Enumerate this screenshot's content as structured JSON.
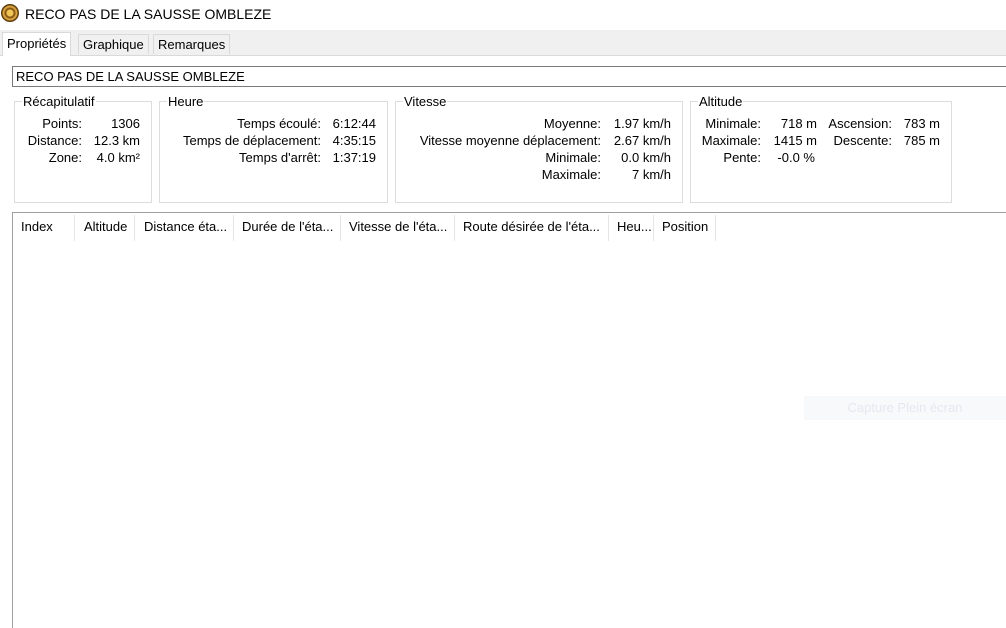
{
  "window": {
    "title": "RECO PAS DE LA SAUSSE OMBLEZE",
    "icon": "app-logo-icon"
  },
  "tabs": [
    {
      "label": "Propriétés",
      "active": true
    },
    {
      "label": "Graphique",
      "active": false
    },
    {
      "label": "Remarques",
      "active": false
    }
  ],
  "name_field": {
    "value": "RECO PAS DE LA SAUSSE OMBLEZE"
  },
  "recap": {
    "title": "Récapitulatif",
    "points_label": "Points:",
    "points_value": "1306",
    "distance_label": "Distance:",
    "distance_value": "12.3 km",
    "zone_label": "Zone:",
    "zone_value": "4.0 km²"
  },
  "heure": {
    "title": "Heure",
    "elapsed_label": "Temps écoulé:",
    "elapsed_value": "6:12:44",
    "moving_label": "Temps de déplacement:",
    "moving_value": "4:35:15",
    "stopped_label": "Temps d'arrêt:",
    "stopped_value": "1:37:19"
  },
  "vitesse": {
    "title": "Vitesse",
    "avg_label": "Moyenne:",
    "avg_value": "1.97 km/h",
    "moving_avg_label": "Vitesse moyenne déplacement:",
    "moving_avg_value": "2.67 km/h",
    "min_label": "Minimale:",
    "min_value": "0.0 km/h",
    "max_label": "Maximale:",
    "max_value": "7 km/h"
  },
  "altitude": {
    "title": "Altitude",
    "min_label": "Minimale:",
    "min_value": "718 m",
    "max_label": "Maximale:",
    "max_value": "1415 m",
    "slope_label": "Pente:",
    "slope_value": "-0.0 %",
    "ascent_label": "Ascension:",
    "ascent_value": "783 m",
    "descent_label": "Descente:",
    "descent_value": "785 m"
  },
  "table": {
    "columns": [
      "Index",
      "Altitude",
      "Distance éta...",
      "Durée de l'éta...",
      "Vitesse de l'éta...",
      "Route désirée de l'éta...",
      "Heu...",
      "Position"
    ],
    "rows": []
  },
  "overlay": {
    "text": "Capture Plein écran"
  }
}
